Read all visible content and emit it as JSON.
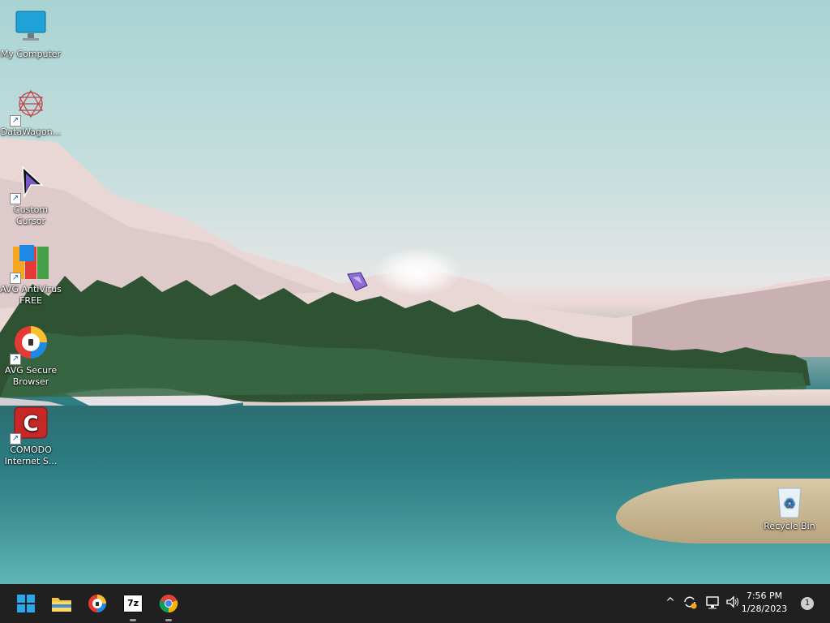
{
  "desktop_icons": [
    {
      "label": "My Computer"
    },
    {
      "label": "DataWagon..."
    },
    {
      "label": "Custom Cursor"
    },
    {
      "label": "AVG AntiVirus FREE"
    },
    {
      "label": "AVG Secure Browser"
    },
    {
      "label": "COMODO Internet S..."
    },
    {
      "label": "Recycle Bin"
    }
  ],
  "taskbar": {
    "apps": [
      {
        "icon": "windows-start-icon"
      },
      {
        "icon": "file-explorer-icon"
      },
      {
        "icon": "avg-secure-browser-icon"
      },
      {
        "icon": "7zip-icon",
        "label": "7z"
      },
      {
        "icon": "chrome-icon"
      }
    ],
    "tray": {
      "chevron": "^",
      "icons": [
        "sync-icon",
        "network-icon",
        "volume-icon"
      ]
    },
    "clock": {
      "time": "7:56 PM",
      "date": "1/28/2023"
    },
    "notifications": {
      "count": "1"
    }
  },
  "colors": {
    "taskbar": "#202020",
    "accent": "#0a84ff"
  }
}
